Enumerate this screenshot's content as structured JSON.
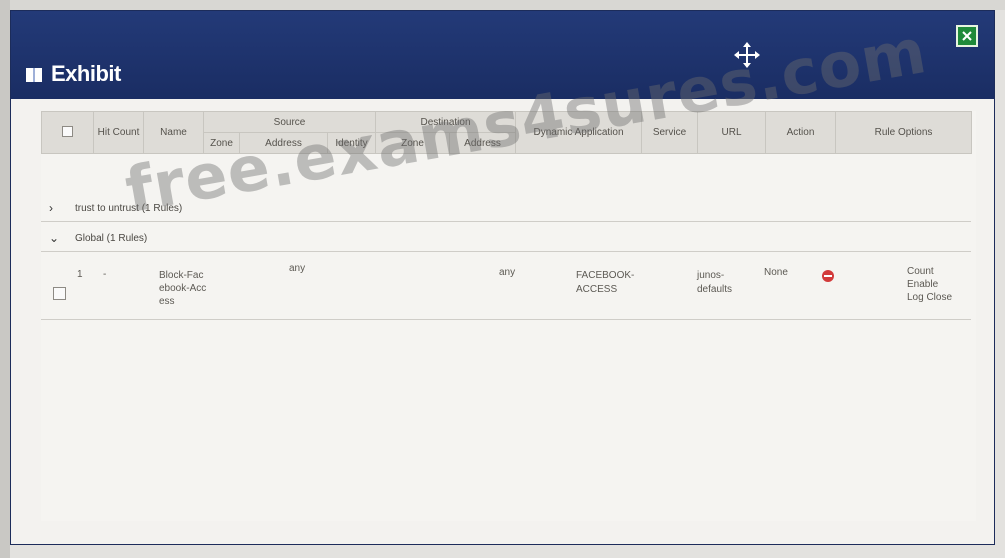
{
  "window": {
    "title": "Exhibit",
    "icons": {
      "title": "book-icon",
      "move": "move-icon",
      "close": "close-icon"
    },
    "colors": {
      "titlebar": "#1a2d63",
      "close": "#1f8a3a",
      "deny": "#d23a3a"
    }
  },
  "table": {
    "headers": {
      "hit_count": "Hit Count",
      "name": "Name",
      "source": "Source",
      "source_zone": "Zone",
      "source_address": "Address",
      "source_identity": "Identity",
      "destination": "Destination",
      "dest_zone": "Zone",
      "dest_address": "Address",
      "dynamic_application": "Dynamic Application",
      "service": "Service",
      "url": "URL",
      "action": "Action",
      "rule_options": "Rule Options"
    },
    "groups": [
      {
        "label": "trust to untrust (1 Rules)",
        "expanded": false
      },
      {
        "label": "Global (1 Rules)",
        "expanded": true
      }
    ],
    "rows": [
      {
        "index": "1",
        "hit_count": "-",
        "name": "Block-Facebook-Access",
        "source_address": "any",
        "dest_address": "any",
        "dynamic_application": "FACEBOOK-ACCESS",
        "service": "junos-defaults",
        "url": "None",
        "action_icon": "deny-icon",
        "rule_options": [
          "Count",
          "Enable",
          "Log Close"
        ]
      }
    ]
  },
  "watermark": "free.exams4sures.com"
}
